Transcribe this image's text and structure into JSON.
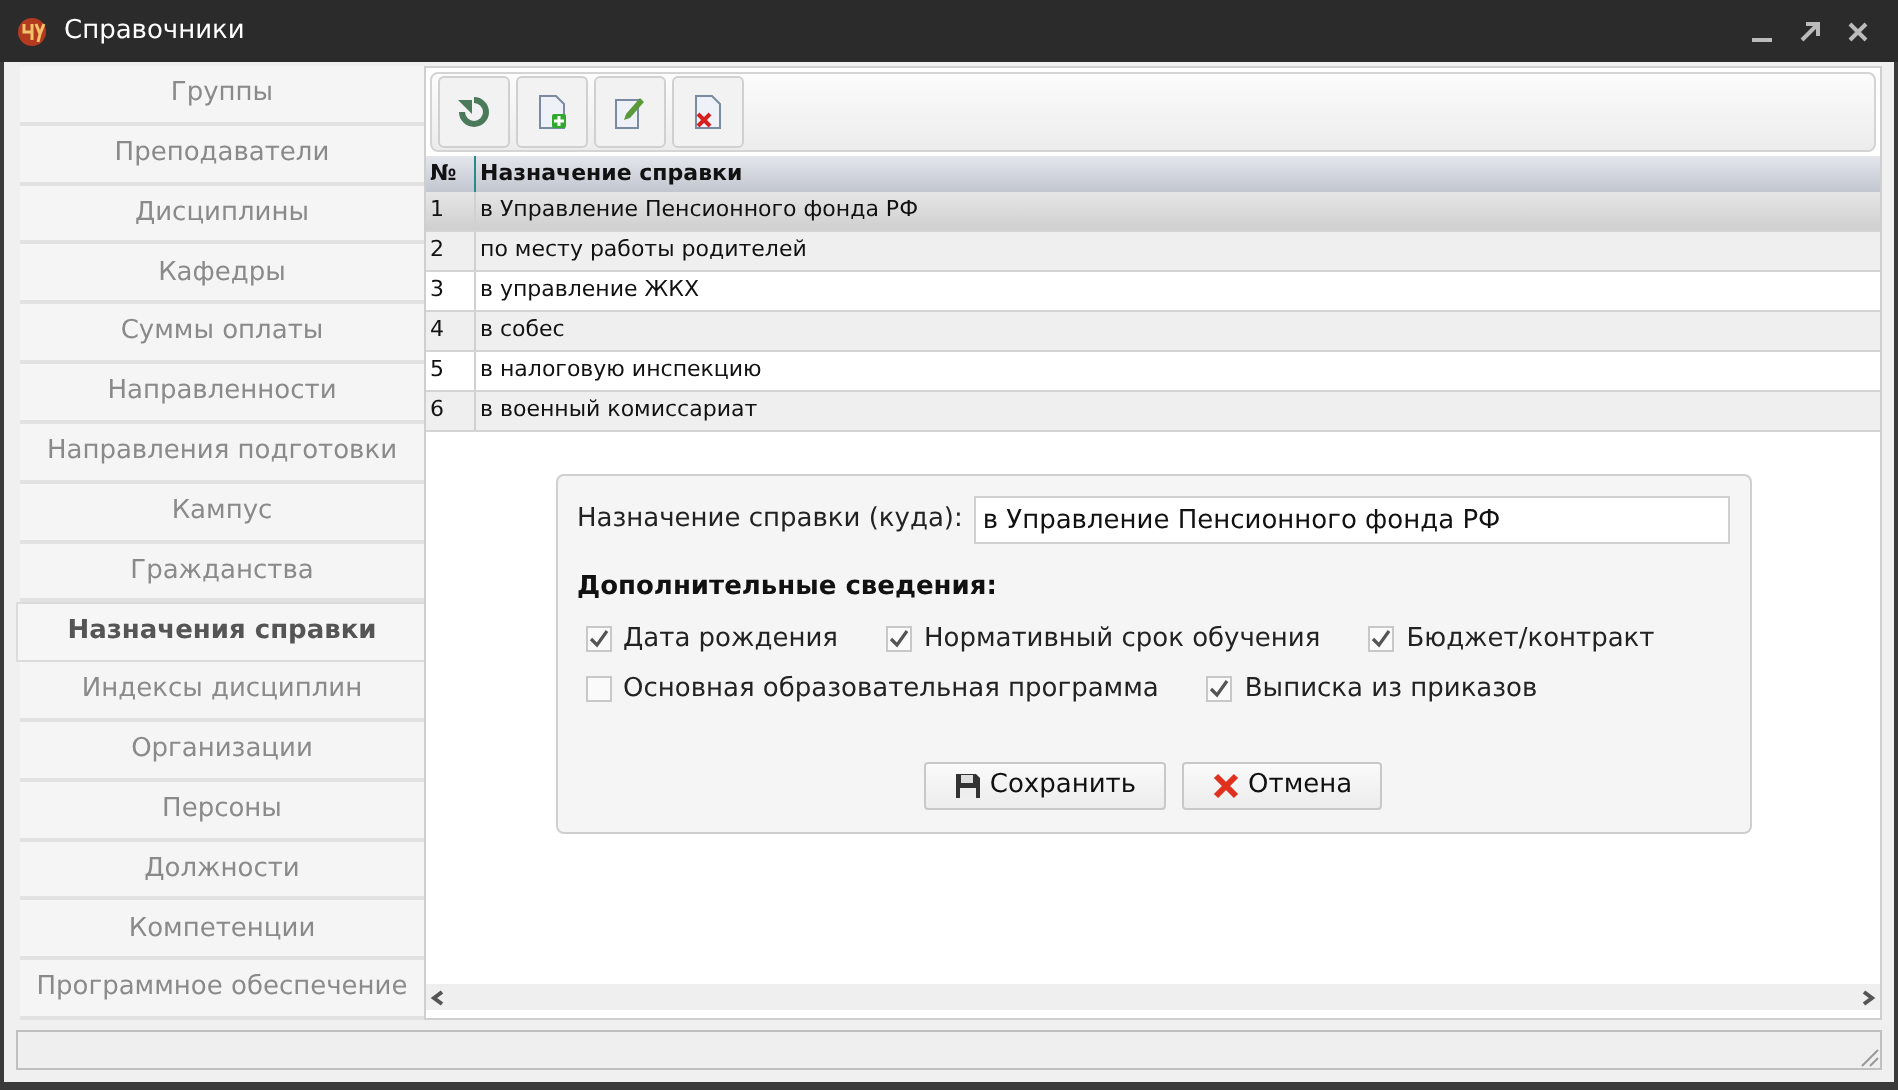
{
  "window": {
    "title": "Справочники"
  },
  "sidebar": {
    "items": [
      {
        "label": "Группы",
        "selected": false
      },
      {
        "label": "Преподаватели",
        "selected": false
      },
      {
        "label": "Дисциплины",
        "selected": false
      },
      {
        "label": "Кафедры",
        "selected": false
      },
      {
        "label": "Суммы оплаты",
        "selected": false
      },
      {
        "label": "Направленности",
        "selected": false
      },
      {
        "label": "Направления подготовки",
        "selected": false
      },
      {
        "label": "Кампус",
        "selected": false
      },
      {
        "label": "Гражданства",
        "selected": false
      },
      {
        "label": "Назначения справки",
        "selected": true
      },
      {
        "label": "Индексы дисциплин",
        "selected": false
      },
      {
        "label": "Организации",
        "selected": false
      },
      {
        "label": "Персоны",
        "selected": false
      },
      {
        "label": "Должности",
        "selected": false
      },
      {
        "label": "Компетенции",
        "selected": false
      },
      {
        "label": "Программное обеспечение",
        "selected": false
      }
    ]
  },
  "toolbar": {
    "buttons": [
      {
        "kind": "refresh"
      },
      {
        "kind": "add"
      },
      {
        "kind": "edit"
      },
      {
        "kind": "delete"
      }
    ]
  },
  "table": {
    "columns": [
      "№",
      "Назначение справки"
    ],
    "rows": [
      {
        "cells": [
          "1",
          "в Управление Пенсионного фонда РФ"
        ],
        "selected": true
      },
      {
        "cells": [
          "2",
          "по месту работы родителей"
        ],
        "selected": false
      },
      {
        "cells": [
          "3",
          "в управление ЖКХ"
        ],
        "selected": false
      },
      {
        "cells": [
          "4",
          "в собес"
        ],
        "selected": false
      },
      {
        "cells": [
          "5",
          "в налоговую инспекцию"
        ],
        "selected": false
      },
      {
        "cells": [
          "6",
          "в военный комиссариат"
        ],
        "selected": false
      }
    ]
  },
  "form": {
    "field": {
      "label": "Назначение справки (куда):",
      "value": "в Управление Пенсионного фонда РФ"
    },
    "section_title": "Дополнительные сведения:",
    "checkbox_rows": [
      [
        {
          "label": "Дата рождения",
          "checked": true
        },
        {
          "label": "Нормативный срок обучения",
          "checked": true
        },
        {
          "label": "Бюджет/контракт",
          "checked": true
        }
      ],
      [
        {
          "label": "Основная образовательная программа",
          "checked": false
        },
        {
          "label": "Выписка из приказов",
          "checked": true
        }
      ]
    ],
    "buttons": [
      {
        "label": "Сохранить",
        "kind": "save"
      },
      {
        "label": "Отмена",
        "kind": "cancel"
      }
    ]
  }
}
